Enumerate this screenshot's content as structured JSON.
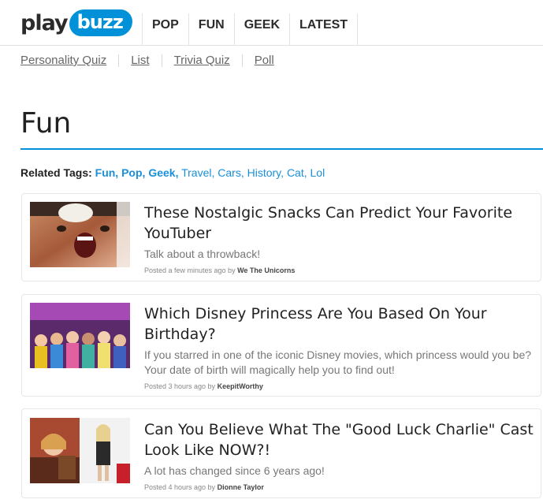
{
  "logo": {
    "part1": "play",
    "part2": "buzz"
  },
  "nav": [
    "POP",
    "FUN",
    "GEEK",
    "LATEST"
  ],
  "subnav": [
    "Personality Quiz",
    "List",
    "Trivia Quiz",
    "Poll"
  ],
  "page_title": "Fun",
  "related_tags": {
    "label": "Related Tags:",
    "bold_tags": [
      "Fun,",
      "Pop,",
      "Geek,"
    ],
    "tags": [
      "Travel,",
      "Cars,",
      "History,",
      "Cat,",
      "Lol"
    ]
  },
  "cards": [
    {
      "title": "These Nostalgic Snacks Can Predict Your Favorite YouTuber",
      "desc": "Talk about a throwback!",
      "meta_prefix": "Posted a few minutes ago by",
      "author": "We The Unicorns"
    },
    {
      "title": "Which Disney Princess Are You Based On Your Birthday?",
      "desc": "If you starred in one of the iconic Disney movies, which princess would you be? Your date of birth will magically help you to find out!",
      "meta_prefix": "Posted 3 hours ago by",
      "author": "KeepitWorthy",
      "thumb_text": "Which Disney Princess Are You Based On Your Birthday?"
    },
    {
      "title": "Can You Believe What The \"Good Luck Charlie\" Cast Look Like NOW?!",
      "desc": "A lot has changed since 6 years ago!",
      "meta_prefix": "Posted 4 hours ago by",
      "author": "Dionne Taylor"
    }
  ],
  "colors": {
    "accent": "#0091d9",
    "tag": "#1a8fd8"
  }
}
